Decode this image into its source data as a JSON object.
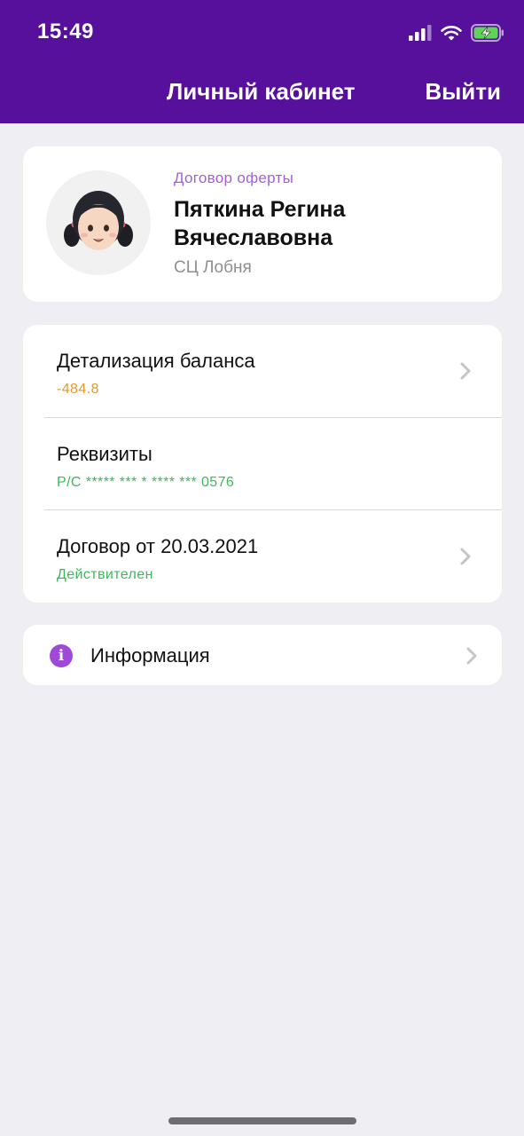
{
  "status_bar": {
    "time": "15:49",
    "icons": [
      "signal-icon",
      "wifi-icon",
      "battery-charging-icon"
    ]
  },
  "nav": {
    "title": "Личный кабинет",
    "logout_label": "Выйти"
  },
  "profile": {
    "contract_type": "Договор оферты",
    "full_name": "Пяткина Регина Вячеславовна",
    "service_center": "СЦ Лобня",
    "avatar": "girl-emoji-avatar"
  },
  "account_items": [
    {
      "title": "Детализация баланса",
      "subtitle": "-484.8",
      "subtitle_color": "#e39a2d",
      "has_chevron": true
    },
    {
      "title": "Реквизиты",
      "subtitle": "Р/С ***** *** * **** *** 0576",
      "subtitle_color": "#3cb95a",
      "has_chevron": false
    },
    {
      "title": "Договор от 20.03.2021",
      "subtitle": "Действителен",
      "subtitle_color": "#3cb95a",
      "has_chevron": true
    }
  ],
  "info": {
    "label": "Информация",
    "icon": "info-icon"
  },
  "colors": {
    "header_bg": "#56109c",
    "page_bg": "#efeef3",
    "accent": "#a048d8"
  }
}
